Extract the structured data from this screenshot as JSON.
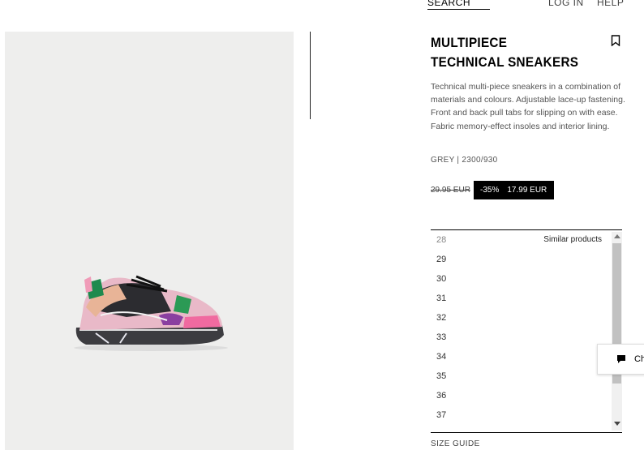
{
  "nav": {
    "search": "SEARCH",
    "login": "LOG IN",
    "help": "HELP"
  },
  "product": {
    "title": "MULTIPIECE TECHNICAL SNEAKERS",
    "description": "Technical multi-piece sneakers in a combination of materials and colours. Adjustable lace-up fastening. Front and back pull tabs for slipping on with ease. Fabric memory-effect insoles and interior lining.",
    "colour_ref": "GREY | 2300/930",
    "old_price": "29.95 EUR",
    "discount": "-35%",
    "new_price": "17.99 EUR"
  },
  "sizes": [
    "28",
    "29",
    "30",
    "31",
    "32",
    "33",
    "34",
    "35",
    "36",
    "37"
  ],
  "similar_products": "Similar products",
  "size_guide": "SIZE GUIDE",
  "chat": {
    "label": "Ch"
  },
  "icons": {
    "bookmark": "bookmark-icon",
    "chat": "chat-bubble-icon"
  }
}
